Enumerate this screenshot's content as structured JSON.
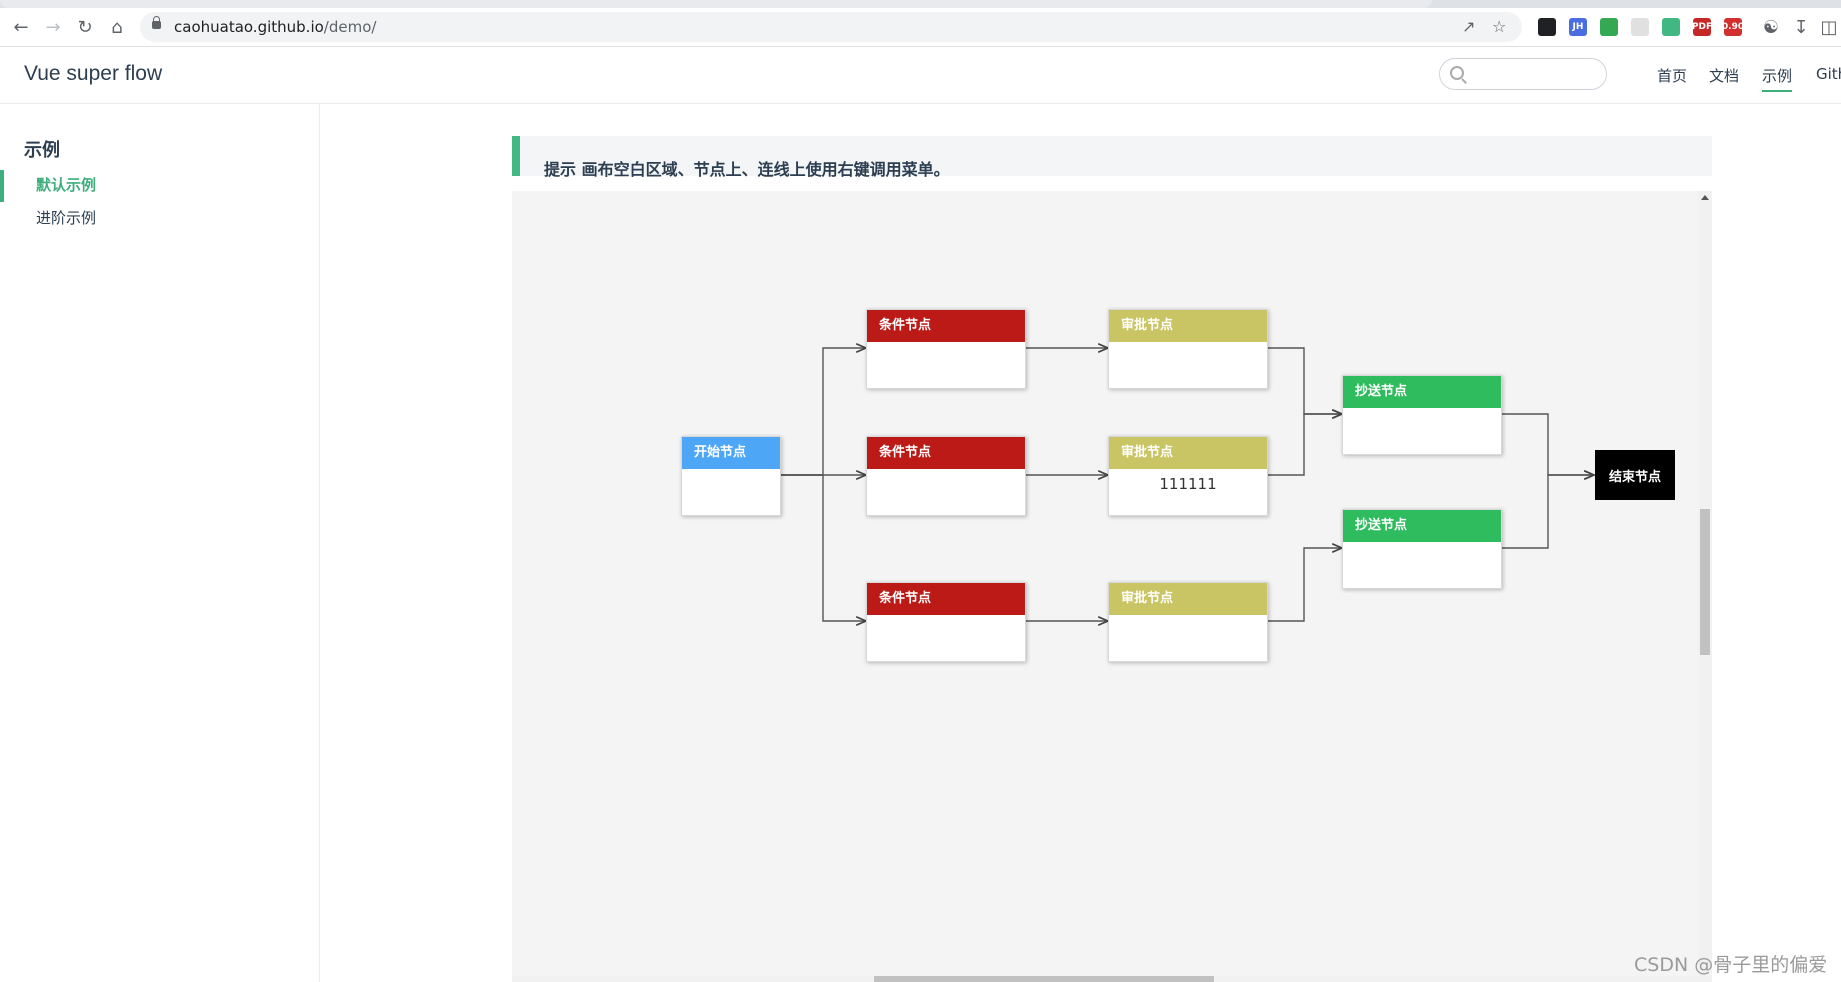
{
  "browser": {
    "url_host": "caohuatao.github.io",
    "url_path": "/demo/",
    "extensions": [
      {
        "name": "ext-black-icon",
        "label": "",
        "color": "#202124"
      },
      {
        "name": "ext-jh-icon",
        "label": "JH",
        "color": "#4a6ee0"
      },
      {
        "name": "ext-diamond-icon",
        "label": "",
        "color": "#34a853"
      },
      {
        "name": "ext-grid-icon",
        "label": "",
        "color": "#e0e0e0"
      },
      {
        "name": "ext-vue-icon",
        "label": "",
        "color": "#41b883"
      },
      {
        "name": "ext-pdf-icon",
        "label": "PDF",
        "color": "#c62828"
      },
      {
        "name": "ext-badge-icon",
        "label": "0.90",
        "color": "#d32f2f"
      }
    ]
  },
  "site": {
    "title": "Vue super flow",
    "search_placeholder": "",
    "nav": [
      "首页",
      "文档",
      "示例",
      "Gith"
    ]
  },
  "sidebar": {
    "heading": "示例",
    "items": [
      {
        "label": "默认示例",
        "active": true
      },
      {
        "label": "进阶示例",
        "active": false
      }
    ]
  },
  "tip": {
    "text": "提示 画布空白区域、节点上、连线上使用右键调用菜单。"
  },
  "flow": {
    "colors": {
      "start": "#4ea6f6",
      "condition": "#bb1a17",
      "approval": "#c9c564",
      "cc": "#2fbc5e",
      "end": "#000000",
      "accent": "#3eaf7c"
    },
    "nodes": {
      "start": {
        "label": "开始节点",
        "content": ""
      },
      "cond1": {
        "label": "条件节点",
        "content": ""
      },
      "cond2": {
        "label": "条件节点",
        "content": ""
      },
      "cond3": {
        "label": "条件节点",
        "content": ""
      },
      "appr1": {
        "label": "审批节点",
        "content": ""
      },
      "appr2": {
        "label": "审批节点",
        "content": "111111"
      },
      "appr3": {
        "label": "审批节点",
        "content": ""
      },
      "cc1": {
        "label": "抄送节点",
        "content": ""
      },
      "cc2": {
        "label": "抄送节点",
        "content": ""
      },
      "end": {
        "label": "结束节点"
      }
    }
  },
  "watermark": "CSDN @骨子里的偏爱"
}
